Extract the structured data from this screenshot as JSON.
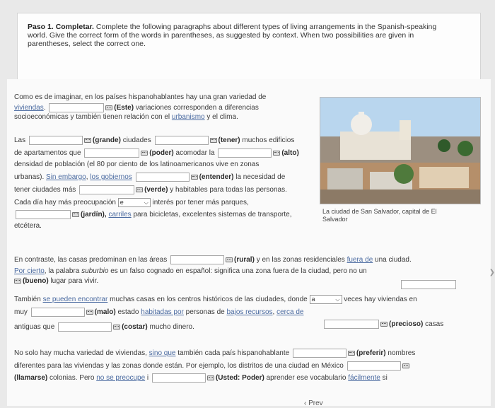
{
  "instructions": {
    "step": "Paso 1. Completar.",
    "text_1": "Complete the following paragraphs about different types of living arrangements in the Spanish-speaking",
    "text_2": "world. Give the correct form of the words in parentheses, as suggested by context. When two possibilities are given in",
    "text_3": "parentheses, select the correct one."
  },
  "p1": {
    "l1": "Como es de imaginar, en los países hispanohablantes hay una gran variedad de",
    "l2a": "viviendas",
    "l2h": "(Este)",
    "l2b": "variaciones corresponden a diferencias",
    "l3a": "socioeconómicas y también tienen relación con el",
    "l3link": "urbanismo",
    "l3b": "y el clima.",
    "l4a": "Las",
    "l4h1": "(grande)",
    "l4b": "ciudades",
    "l4h2": "(tener)",
    "l4c": "muchos edificios",
    "l5a": "de apartamentos que",
    "l5h1": "(poder)",
    "l5b": "acomodar la",
    "l5h2": "(alto)",
    "l6": "densidad de población (el 80 por ciento de los latinoamericanos vive en zonas",
    "l7a": "urbanas).",
    "l7link1": "Sin embargo",
    "l7link2": "los gobiernos",
    "l7h": "(entender)",
    "l7b": "la necesidad de",
    "l8a": "tener ciudades más",
    "l8h": "(verde)",
    "l8b": "y habitables para todas las personas.",
    "l9a": "Cada día hay más preocupación",
    "l9sel": "e",
    "l9b": "interés por tener más parques,",
    "l10h": "(jardín),",
    "l10link": "carriles",
    "l10b": "para bicicletas, excelentes sistemas de transporte,",
    "l11": "etcétera."
  },
  "photo": {
    "caption_1": "La ciudad de San Salvador, capital de El",
    "caption_2": "Salvador"
  },
  "p2": {
    "l1a": "En contraste, las casas predominan en las áreas",
    "l1h": "(rural)",
    "l1b": "y en las zonas residenciales",
    "l1link": "fuera de",
    "l1c": "una ciudad.",
    "l2link": "Por cierto",
    "l2b": ", la palabra",
    "l2i": "suburbio",
    "l2c": "es un falso cognado en español: significa una zona fuera de la ciudad, pero no un",
    "l3h": "(bueno)",
    "l3b": "lugar para vivir."
  },
  "p3": {
    "l1a": "También",
    "l1link": "se pueden encontrar",
    "l1b": "muchas casas en los centros históricos de las ciudades, donde",
    "l1sel": "a",
    "l1c": "veces hay viviendas en",
    "l2a": "muy",
    "l2h": "(malo)",
    "l2b": "estado",
    "l2link1": "habitadas por",
    "l2c": "personas de",
    "l2link2": "bajos recursos",
    "l2link3": "cerca de",
    "l3a": "antiguas que",
    "l3h": "(costar)",
    "l3b": "mucho dinero.",
    "l3h2": "(precioso)",
    "l3c": "casas"
  },
  "p4": {
    "l1a": "No solo hay mucha variedad de viviendas,",
    "l1link": "sino que",
    "l1b": "también cada país hispanohablante",
    "l1h": "(preferir)",
    "l1c": "nombres",
    "l2a": "diferentes para las viviendas y las zonas donde están. Por ejemplo, los distritos de una ciudad en México",
    "l3h0": "(llamarse)",
    "l3a": "colonias. Pero",
    "l3link": "no se preocupe",
    "l3b": "i",
    "l3h": "(Usted: Poder)",
    "l3c": "aprender ese vocabulario",
    "l3link2": "fácilmente",
    "l3d": "si"
  },
  "nav": {
    "prev": "Prev"
  }
}
